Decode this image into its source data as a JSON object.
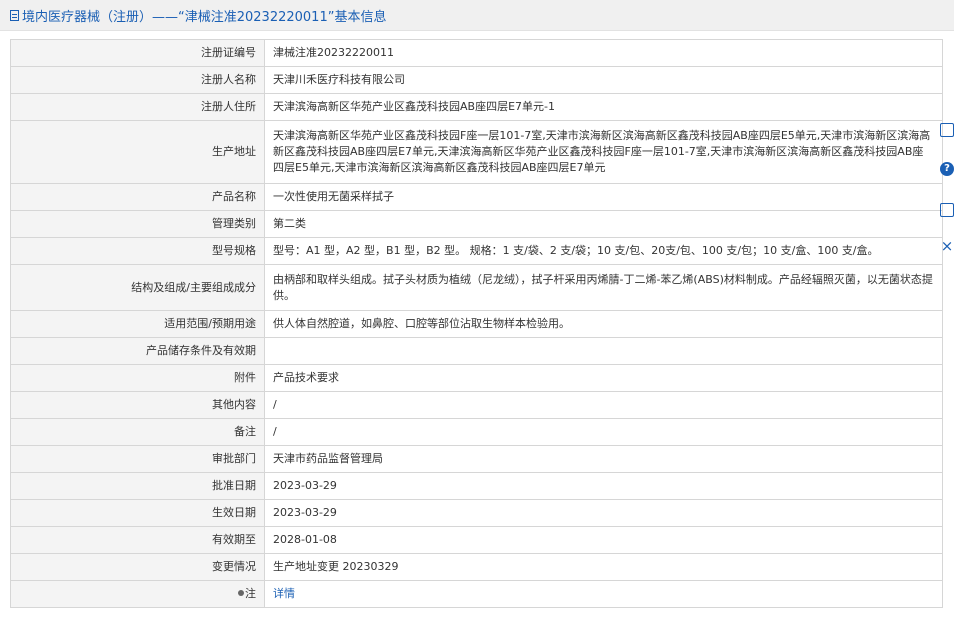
{
  "header": {
    "title": "境内医疗器械（注册）——“津械注准20232220011”基本信息"
  },
  "rows": [
    {
      "label": "注册证编号",
      "value": "津械注准20232220011"
    },
    {
      "label": "注册人名称",
      "value": "天津川禾医疗科技有限公司"
    },
    {
      "label": "注册人住所",
      "value": "天津滨海高新区华苑产业区鑫茂科技园AB座四层E7单元-1"
    },
    {
      "label": "生产地址",
      "value": "天津滨海高新区华苑产业区鑫茂科技园F座一层101-7室,天津市滨海新区滨海高新区鑫茂科技园AB座四层E5单元,天津市滨海新区滨海高新区鑫茂科技园AB座四层E7单元,天津滨海高新区华苑产业区鑫茂科技园F座一层101-7室,天津市滨海新区滨海高新区鑫茂科技园AB座四层E5单元,天津市滨海新区滨海高新区鑫茂科技园AB座四层E7单元"
    },
    {
      "label": "产品名称",
      "value": "一次性使用无菌采样拭子"
    },
    {
      "label": "管理类别",
      "value": "第二类"
    },
    {
      "label": "型号规格",
      "value": "型号：A1 型，A2 型，B1 型，B2 型。 规格：1 支/袋、2 支/袋；10 支/包、20支/包、100 支/包；10 支/盒、100 支/盒。"
    },
    {
      "label": "结构及组成/主要组成成分",
      "value": "由柄部和取样头组成。拭子头材质为植绒（尼龙绒），拭子杆采用丙烯腈-丁二烯-苯乙烯(ABS)材料制成。产品经辐照灭菌，以无菌状态提供。"
    },
    {
      "label": "适用范围/预期用途",
      "value": "供人体自然腔道，如鼻腔、口腔等部位沾取生物样本检验用。"
    },
    {
      "label": "产品储存条件及有效期",
      "value": ""
    },
    {
      "label": "附件",
      "value": "产品技术要求"
    },
    {
      "label": "其他内容",
      "value": "/"
    },
    {
      "label": "备注",
      "value": "/"
    },
    {
      "label": "审批部门",
      "value": "天津市药品监督管理局"
    },
    {
      "label": "批准日期",
      "value": "2023-03-29"
    },
    {
      "label": "生效日期",
      "value": "2023-03-29"
    },
    {
      "label": "有效期至",
      "value": "2028-01-08"
    },
    {
      "label": "变更情况",
      "value": "生产地址变更 20230329"
    }
  ],
  "note": {
    "label": "注",
    "link": "详情"
  },
  "side_tools": {
    "help_glyph": "?",
    "close_glyph": "×"
  }
}
